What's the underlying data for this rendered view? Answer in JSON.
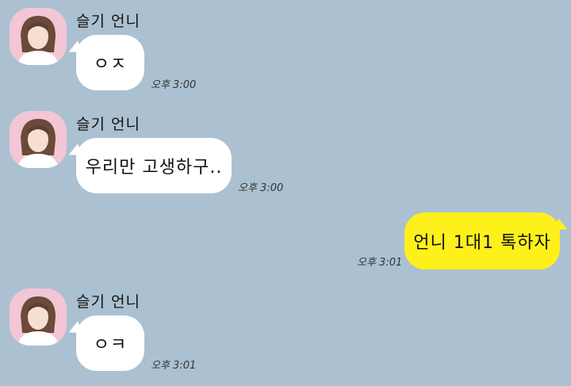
{
  "chat": {
    "background_color": "#abc1d1",
    "incoming_bubble_color": "#ffffff",
    "outgoing_bubble_color": "#fef01b",
    "messages": [
      {
        "sender": "슬기 언니",
        "text": "ㅇㅈ",
        "time": "오후 3:00",
        "direction": "incoming"
      },
      {
        "sender": "슬기 언니",
        "text": "우리만 고생하구..",
        "time": "오후 3:00",
        "direction": "incoming"
      },
      {
        "sender": "",
        "text": "언니 1대1 톡하자",
        "time": "오후 3:01",
        "direction": "outgoing"
      },
      {
        "sender": "슬기 언니",
        "text": "ㅇㅋ",
        "time": "오후 3:01",
        "direction": "incoming"
      }
    ]
  }
}
